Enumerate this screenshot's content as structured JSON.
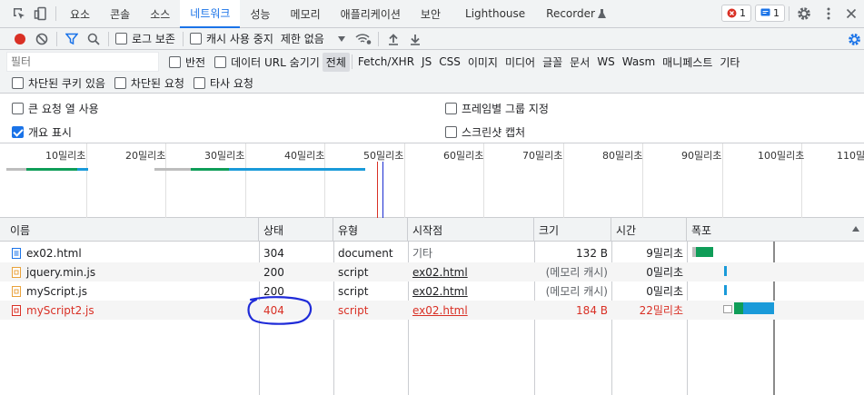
{
  "tabs": [
    {
      "label": "요소"
    },
    {
      "label": "콘솔"
    },
    {
      "label": "소스"
    },
    {
      "label": "네트워크",
      "active": true
    },
    {
      "label": "성능"
    },
    {
      "label": "메모리"
    },
    {
      "label": "애플리케이션"
    },
    {
      "label": "보안"
    },
    {
      "label": "Lighthouse"
    },
    {
      "label": "Recorder"
    }
  ],
  "badges": {
    "errors": "1",
    "messages": "1"
  },
  "toolbar": {
    "preserve_log": "로그 보존",
    "disable_cache": "캐시 사용 중지",
    "throttling": "제한 없음"
  },
  "filter": {
    "placeholder": "필터",
    "invert": "반전",
    "hide_data_urls": "데이터 URL 숨기기",
    "types": [
      "전체",
      "Fetch/XHR",
      "JS",
      "CSS",
      "이미지",
      "미디어",
      "글꼴",
      "문서",
      "WS",
      "Wasm",
      "매니페스트",
      "기타"
    ],
    "blocked_cookies": "차단된 쿠키 있음",
    "blocked_requests": "차단된 요청",
    "third_party": "타사 요청"
  },
  "settings": {
    "big_rows": "큰 요청 열 사용",
    "group_by_frame": "프레임별 그룹 지정",
    "overview": "개요 표시",
    "screenshots": "스크린샷 캡처"
  },
  "overview": {
    "ticks": [
      "10밀리초",
      "20밀리초",
      "30밀리초",
      "40밀리초",
      "50밀리초",
      "60밀리초",
      "70밀리초",
      "80밀리초",
      "90밀리초",
      "100밀리초",
      "110밀리초"
    ]
  },
  "table": {
    "headers": [
      "이름",
      "상태",
      "유형",
      "시작점",
      "크기",
      "시간",
      "폭포"
    ],
    "rows": [
      {
        "name": "ex02.html",
        "status": "304",
        "type": "document",
        "initiator": "기타",
        "size": "132 B",
        "time": "9밀리초",
        "error": false
      },
      {
        "name": "jquery.min.js",
        "status": "200",
        "type": "script",
        "initiator": "ex02.html",
        "size": "(메모리 캐시)",
        "time": "0밀리초",
        "error": false
      },
      {
        "name": "myScript.js",
        "status": "200",
        "type": "script",
        "initiator": "ex02.html",
        "size": "(메모리 캐시)",
        "time": "0밀리초",
        "error": false
      },
      {
        "name": "myScript2.js",
        "status": "404",
        "type": "script",
        "initiator": "ex02.html",
        "size": "184 B",
        "time": "22밀리초",
        "error": true
      }
    ]
  }
}
